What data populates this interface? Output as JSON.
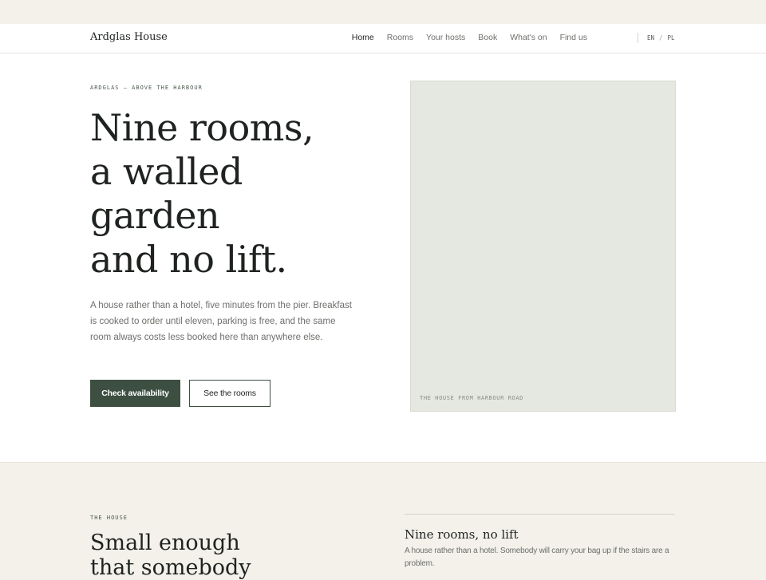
{
  "brand": {
    "name": "Ardglas House"
  },
  "nav": {
    "items": [
      {
        "label": "Home",
        "active": true
      },
      {
        "label": "Rooms",
        "active": false
      },
      {
        "label": "Your hosts",
        "active": false
      },
      {
        "label": "Book",
        "active": false
      },
      {
        "label": "What's on",
        "active": false
      },
      {
        "label": "Find us",
        "active": false
      }
    ],
    "languages": [
      "EN",
      "/",
      "PL"
    ]
  },
  "hero": {
    "eyebrow": "ARDGLAS — ABOVE THE HARBOUR",
    "headline_lines": [
      "Nine rooms,",
      "a walled",
      "garden",
      "and no lift."
    ],
    "lede": "A house rather than a hotel, five minutes from the pier. Breakfast is cooked to order until eleven, parking is free, and the same room always costs less booked here than anywhere else.",
    "primary_button": "Check availability",
    "secondary_button": "See the rooms",
    "image_caption": "THE HOUSE FROM HARBOUR ROAD"
  },
  "house_section": {
    "eyebrow": "THE HOUSE",
    "title_lines": [
      "Small enough",
      "that somebody"
    ],
    "feature": {
      "title": "Nine rooms, no lift",
      "text": "A house rather than a hotel. Somebody will carry your bag up if the stairs are a problem."
    }
  },
  "colors": {
    "accent": "#3d4f41",
    "background": "#f3f1ea",
    "surface": "#ffffff",
    "muted_text": "#6d706b"
  }
}
